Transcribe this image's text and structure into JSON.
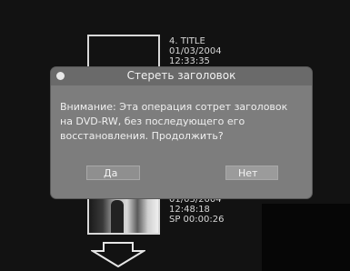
{
  "entries": [
    {
      "lines": [
        "4. TITLE",
        "01/03/2004",
        "12:33:35"
      ]
    },
    {
      "lines": [
        "01/03/2004",
        "12:48:18",
        "SP 00:00:26"
      ]
    }
  ],
  "dialog": {
    "title": "Стереть заголовок",
    "message": [
      "Внимание: Эта операция сотрет заголовок",
      "на DVD-RW, без последующего его",
      "восстановления. Продолжить?"
    ],
    "yes_label": "Да",
    "no_label": "Нет"
  },
  "icons": {
    "down_arrow": "down-arrow-icon",
    "dialog_bullet": "bullet-icon"
  }
}
